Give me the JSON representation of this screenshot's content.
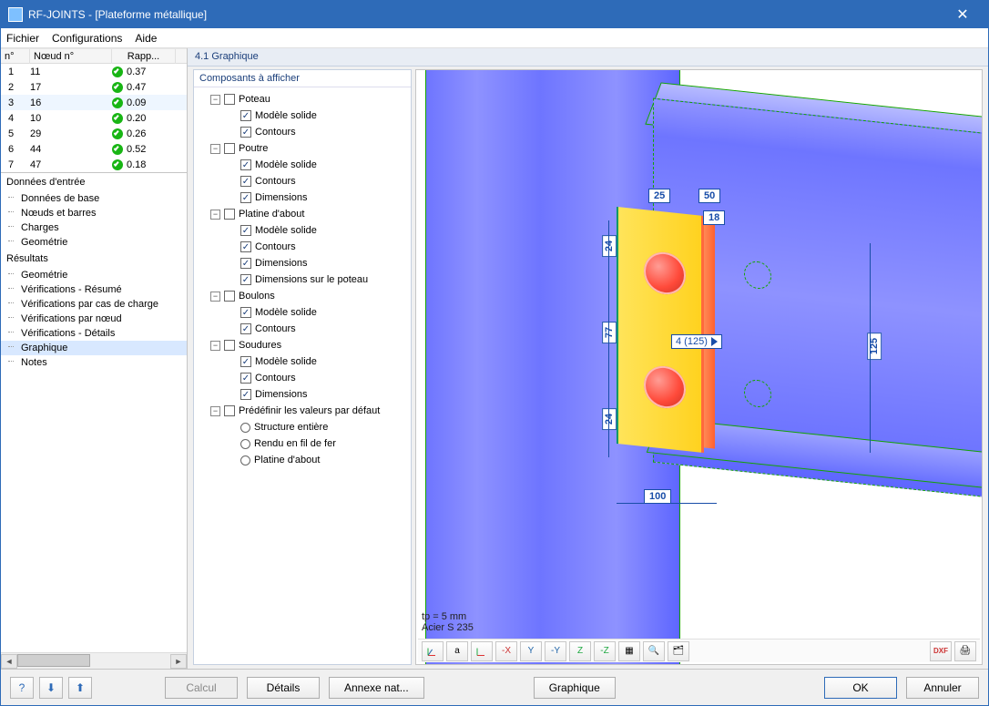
{
  "window": {
    "title": "RF-JOINTS - [Plateforme métallique]"
  },
  "menu": {
    "file": "Fichier",
    "config": "Configurations",
    "help": "Aide"
  },
  "grid": {
    "headers": {
      "no": "n°",
      "node": "Nœud n°",
      "ratio": "Rapp..."
    },
    "rows": [
      {
        "no": "1",
        "node": "11",
        "ratio": "0.37"
      },
      {
        "no": "2",
        "node": "17",
        "ratio": "0.47"
      },
      {
        "no": "3",
        "node": "16",
        "ratio": "0.09",
        "sel": true
      },
      {
        "no": "4",
        "node": "10",
        "ratio": "0.20"
      },
      {
        "no": "5",
        "node": "29",
        "ratio": "0.26"
      },
      {
        "no": "6",
        "node": "44",
        "ratio": "0.52"
      },
      {
        "no": "7",
        "node": "47",
        "ratio": "0.18"
      }
    ]
  },
  "nav": {
    "input_title": "Données d'entrée",
    "input_items": [
      "Données de base",
      "Nœuds et barres",
      "Charges",
      "Geométrie"
    ],
    "result_title": "Résultats",
    "result_items": [
      "Geométrie",
      "Vérifications - Résumé",
      "Vérifications par cas de charge",
      "Vérifications par nœud",
      "Vérifications - Détails",
      "Graphique",
      "Notes"
    ],
    "selected": "Graphique"
  },
  "panel": {
    "title": "4.1 Graphique",
    "tree_title": "Composants à afficher",
    "tree": {
      "poteau": {
        "label": "Poteau",
        "children": [
          {
            "label": "Modèle solide",
            "chk": true
          },
          {
            "label": "Contours",
            "chk": true
          }
        ]
      },
      "poutre": {
        "label": "Poutre",
        "children": [
          {
            "label": "Modèle solide",
            "chk": true
          },
          {
            "label": "Contours",
            "chk": true
          },
          {
            "label": "Dimensions",
            "chk": true
          }
        ]
      },
      "platine": {
        "label": "Platine d'about",
        "children": [
          {
            "label": "Modèle solide",
            "chk": true
          },
          {
            "label": "Contours",
            "chk": true
          },
          {
            "label": "Dimensions",
            "chk": true
          },
          {
            "label": "Dimensions sur le poteau",
            "chk": true
          }
        ]
      },
      "boulons": {
        "label": "Boulons",
        "children": [
          {
            "label": "Modèle solide",
            "chk": true
          },
          {
            "label": "Contours",
            "chk": true
          }
        ]
      },
      "soudures": {
        "label": "Soudures",
        "children": [
          {
            "label": "Modèle solide",
            "chk": true
          },
          {
            "label": "Contours",
            "chk": true
          },
          {
            "label": "Dimensions",
            "chk": true
          }
        ]
      },
      "defaults": {
        "label": "Prédéfinir les valeurs par défaut",
        "children": [
          {
            "label": "Structure entière",
            "radio": true
          },
          {
            "label": "Rendu en fil de fer",
            "radio": true
          },
          {
            "label": "Platine d'about",
            "radio": true
          }
        ]
      }
    }
  },
  "scene": {
    "info_tp": "tp = 5 mm",
    "info_mat": "Acier S 235",
    "callout": "4 (125)",
    "dims": {
      "d25": "25",
      "d50": "50",
      "d18": "18",
      "d24a": "24",
      "d77": "77",
      "d24b": "24",
      "d100": "100",
      "d125": "125"
    }
  },
  "buttons": {
    "calcul": "Calcul",
    "details": "Détails",
    "annexe": "Annexe nat...",
    "graphique": "Graphique",
    "ok": "OK",
    "annuler": "Annuler"
  },
  "tb_right": {
    "dxf": "DXF"
  }
}
